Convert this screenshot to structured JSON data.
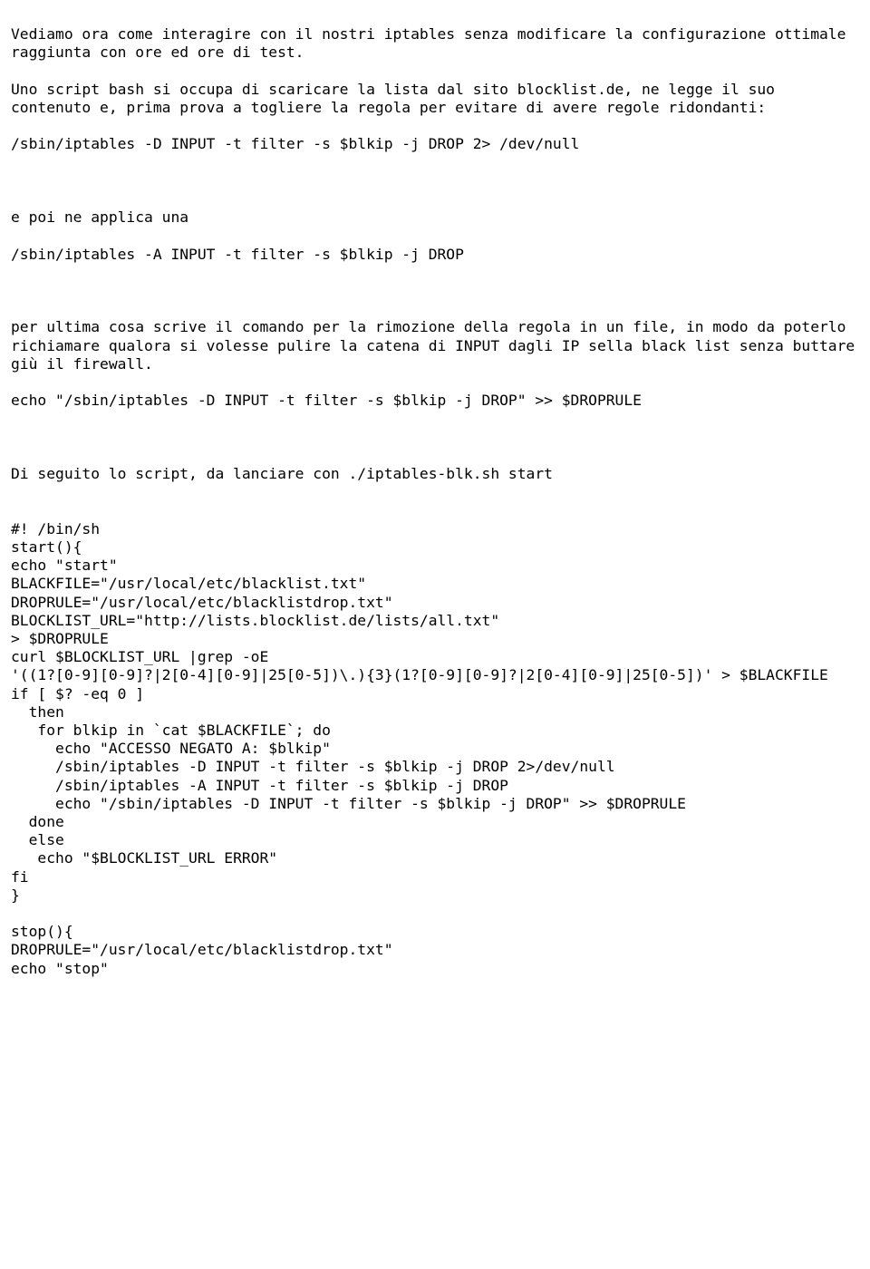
{
  "p1": "Vediamo ora come interagire con il nostri iptables senza modificare la configurazione ottimale raggiunta con ore ed ore di test.",
  "p2": "Uno script bash si occupa di scaricare la lista dal sito blocklist.de, ne legge il suo contenuto e, prima prova a togliere la regola per evitare di avere regole ridondanti:",
  "cmd1": "/sbin/iptables -D INPUT -t filter -s $blkip -j DROP 2> /dev/null",
  "p3": "e poi ne applica una",
  "cmd2": "/sbin/iptables -A INPUT -t filter -s $blkip -j DROP",
  "p4": "per ultima cosa scrive il comando per la rimozione della regola in un file, in modo da poterlo richiamare qualora si volesse pulire la catena di INPUT dagli IP sella black list senza buttare giù il firewall.",
  "cmd3": "echo \"/sbin/iptables -D INPUT -t filter -s $blkip -j DROP\" >> $DROPRULE",
  "p5": "Di seguito lo script, da lanciare con ./iptables-blk.sh start",
  "s01": "#! /bin/sh",
  "s02": "start(){",
  "s03": "echo \"start\"",
  "s04": "BLACKFILE=\"/usr/local/etc/blacklist.txt\"",
  "s05": "DROPRULE=\"/usr/local/etc/blacklistdrop.txt\"",
  "s06": "BLOCKLIST_URL=\"http://lists.blocklist.de/lists/all.txt\"",
  "s07": "> $DROPRULE",
  "s08": "curl $BLOCKLIST_URL |grep -oE",
  "s09": "'((1?[0-9][0-9]?|2[0-4][0-9]|25[0-5])\\.){3}(1?[0-9][0-9]?|2[0-4][0-9]|25[0-5])' > $BLACKFILE",
  "s10": "if [ $? -eq 0 ]",
  "s11": "  then",
  "s12": "   for blkip in `cat $BLACKFILE`; do",
  "s13": "     echo \"ACCESSO NEGATO A: $blkip\"",
  "s14": "     /sbin/iptables -D INPUT -t filter -s $blkip -j DROP 2>/dev/null",
  "s15": "     /sbin/iptables -A INPUT -t filter -s $blkip -j DROP",
  "s16": "     echo \"/sbin/iptables -D INPUT -t filter -s $blkip -j DROP\" >> $DROPRULE",
  "s17": "  done",
  "s18": "  else",
  "s19": "   echo \"$BLOCKLIST_URL ERROR\"",
  "s20": "fi",
  "s21": "}",
  "s22": "stop(){",
  "s23": "DROPRULE=\"/usr/local/etc/blacklistdrop.txt\"",
  "s24": "echo \"stop\""
}
